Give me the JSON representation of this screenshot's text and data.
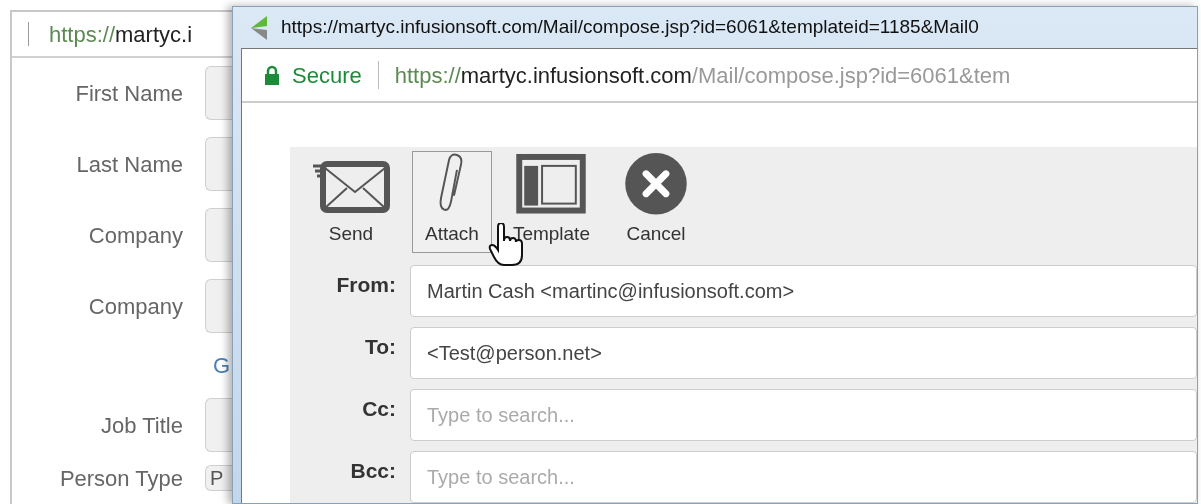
{
  "back_window": {
    "url": {
      "scheme": "https://",
      "host": "martyc.i"
    },
    "fields": [
      {
        "label": "First Name"
      },
      {
        "label": "Last Name"
      },
      {
        "label": "Company"
      },
      {
        "label": "Company"
      },
      {
        "kind": "link",
        "label": "G"
      },
      {
        "label": "Job Title"
      },
      {
        "label": "Person Type",
        "value": "P"
      }
    ]
  },
  "window": {
    "title": "https://martyc.infusionsoft.com/Mail/compose.jsp?id=6061&templateid=1185&Mail0",
    "secure_label": "Secure",
    "url": {
      "scheme": "https://",
      "host": "martyc.infusionsoft.com",
      "path": "/Mail/compose.jsp?id=6061&tem"
    }
  },
  "toolbar": [
    {
      "kind": "send",
      "label": "Send",
      "selected": false
    },
    {
      "kind": "attach",
      "label": "Attach",
      "selected": true
    },
    {
      "kind": "template",
      "label": "Template",
      "selected": false
    },
    {
      "kind": "cancel",
      "label": "Cancel",
      "selected": false
    }
  ],
  "recipients": [
    {
      "label": "From:",
      "value": "Martin Cash <martinc@infusionsoft.com>"
    },
    {
      "label": "To:",
      "value": "<Test@person.net>"
    },
    {
      "label": "Cc:",
      "placeholder": "Type to search..."
    },
    {
      "label": "Bcc:",
      "placeholder": "Type to search..."
    }
  ]
}
